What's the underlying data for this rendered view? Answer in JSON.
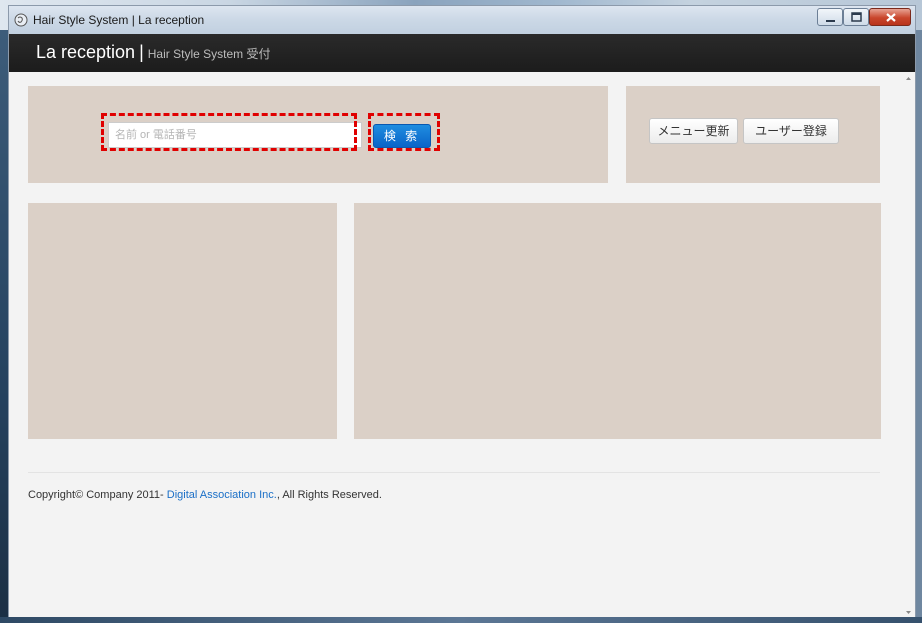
{
  "window": {
    "title": "Hair Style System | La reception"
  },
  "navbar": {
    "brand": "La reception",
    "separator": "|",
    "subtitle": "Hair Style System 受付"
  },
  "search": {
    "placeholder": "名前 or 電話番号",
    "value": "",
    "button_label": "検 索"
  },
  "actions": {
    "menu_update_label": "メニュー更新",
    "user_register_label": "ユーザー登録"
  },
  "footer": {
    "prefix": "Copyright© Company 2011- ",
    "link_text": "Digital Association Inc.",
    "suffix": ", All Rights Reserved."
  },
  "colors": {
    "panel": "#dbd0c7",
    "navbar": "#1c1c1c",
    "primary_button": "#0a64c8",
    "highlight": "#e00000",
    "link": "#1a6fc7"
  },
  "icons": {
    "app": "globe-icon",
    "minimize": "minimize-icon",
    "maximize": "maximize-icon",
    "close": "close-icon"
  }
}
